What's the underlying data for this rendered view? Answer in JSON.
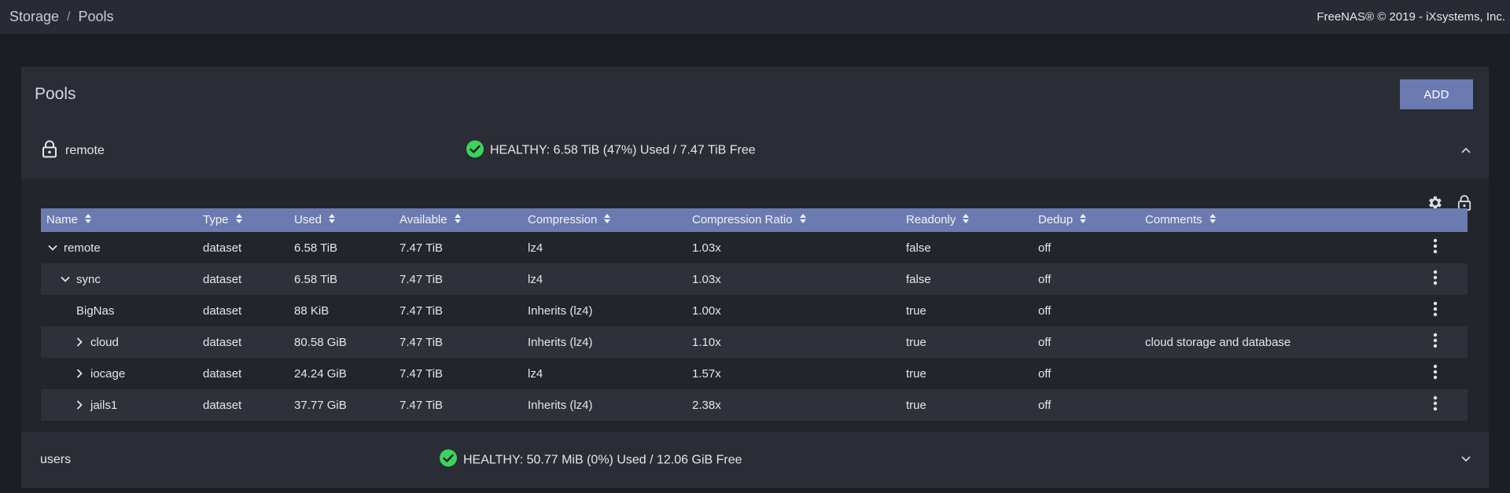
{
  "topbar": {
    "breadcrumb": [
      "Storage",
      "Pools"
    ],
    "separator": "/",
    "copyright": "FreeNAS® © 2019 - iXsystems, Inc."
  },
  "card": {
    "title": "Pools",
    "add_label": "ADD"
  },
  "pools": [
    {
      "name": "remote",
      "status": "HEALTHY: 6.58 TiB (47%) Used / 7.47 TiB Free",
      "expanded": true
    },
    {
      "name": "users",
      "status": "HEALTHY: 50.77 MiB (0%) Used / 12.06 GiB Free",
      "expanded": false
    }
  ],
  "table": {
    "columns": [
      "Name",
      "Type",
      "Used",
      "Available",
      "Compression",
      "Compression Ratio",
      "Readonly",
      "Dedup",
      "Comments"
    ],
    "rows": [
      {
        "name": "remote",
        "toggle": "down",
        "type": "dataset",
        "used": "6.58 TiB",
        "available": "7.47 TiB",
        "compression": "lz4",
        "ratio": "1.03x",
        "readonly": "false",
        "dedup": "off",
        "comments": ""
      },
      {
        "name": "sync",
        "toggle": "down",
        "type": "dataset",
        "used": "6.58 TiB",
        "available": "7.47 TiB",
        "compression": "lz4",
        "ratio": "1.03x",
        "readonly": "false",
        "dedup": "off",
        "comments": ""
      },
      {
        "name": "BigNas",
        "toggle": "none",
        "type": "dataset",
        "used": "88 KiB",
        "available": "7.47 TiB",
        "compression": "Inherits (lz4)",
        "ratio": "1.00x",
        "readonly": "true",
        "dedup": "off",
        "comments": ""
      },
      {
        "name": "cloud",
        "toggle": "right",
        "type": "dataset",
        "used": "80.58 GiB",
        "available": "7.47 TiB",
        "compression": "Inherits (lz4)",
        "ratio": "1.10x",
        "readonly": "true",
        "dedup": "off",
        "comments": "cloud storage and database"
      },
      {
        "name": "iocage",
        "toggle": "right",
        "type": "dataset",
        "used": "24.24 GiB",
        "available": "7.47 TiB",
        "compression": "lz4",
        "ratio": "1.57x",
        "readonly": "true",
        "dedup": "off",
        "comments": ""
      },
      {
        "name": "jails1",
        "toggle": "right",
        "type": "dataset",
        "used": "37.77 GiB",
        "available": "7.47 TiB",
        "compression": "Inherits (lz4)",
        "ratio": "2.38x",
        "readonly": "true",
        "dedup": "off",
        "comments": ""
      }
    ]
  },
  "icons": {
    "lock": "lock-icon",
    "check": "check-circle-icon",
    "settings": "gear-icon",
    "encryption": "lock-icon",
    "collapse": "chevron-up-icon",
    "expand": "chevron-down-icon",
    "kebab": "more-vert-icon"
  },
  "colors": {
    "accent": "#6b7bb1",
    "healthy": "#3cd35d"
  }
}
